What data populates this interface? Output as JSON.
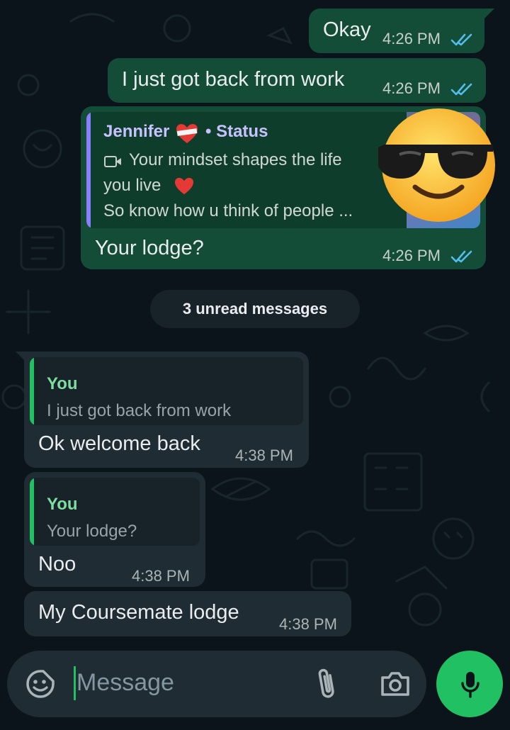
{
  "colors": {
    "outgoing_bubble": "#144d37",
    "incoming_bubble": "#1f2c33",
    "read_ticks": "#53bdeb",
    "quote_you_accent": "#21c063",
    "quote_status_accent": "#8b7fff",
    "mic_button": "#21c063"
  },
  "messages": [
    {
      "text": "Okay",
      "time": "4:26 PM",
      "direction": "outgoing",
      "status_icon": "double-check-read-icon"
    },
    {
      "text": "I just got back from work",
      "time": "4:26 PM",
      "direction": "outgoing",
      "status_icon": "double-check-read-icon"
    },
    {
      "text": "Your lodge?",
      "time": "4:26 PM",
      "direction": "outgoing",
      "status_icon": "double-check-read-icon",
      "reply": {
        "author": "Jennifer",
        "author_emoji": "heart-with-bandage-emoji",
        "suffix": "• Status",
        "media_icon": "video-icon",
        "line1": "Your mindset shapes the life",
        "line2": "you live",
        "line2_emoji": "red-heart-emoji",
        "line3": "So know how u think of people ...",
        "thumbnail": "status-thumbnail-sunglasses-emoji"
      }
    },
    {
      "text": "Ok welcome back",
      "time": "4:38 PM",
      "direction": "incoming",
      "reply": {
        "author": "You",
        "text": "I just got back from work"
      }
    },
    {
      "text": "Noo",
      "time": "4:38 PM",
      "direction": "incoming",
      "reply": {
        "author": "You",
        "text": "Your lodge?"
      }
    },
    {
      "text": "My Coursemate lodge",
      "time": "4:38 PM",
      "direction": "incoming"
    }
  ],
  "unread_divider": "3 unread messages",
  "composer": {
    "placeholder": "Message",
    "left_icon": "sticker-icon",
    "attach_icon": "paperclip-icon",
    "camera_icon": "camera-icon",
    "send_icon": "microphone-icon"
  }
}
